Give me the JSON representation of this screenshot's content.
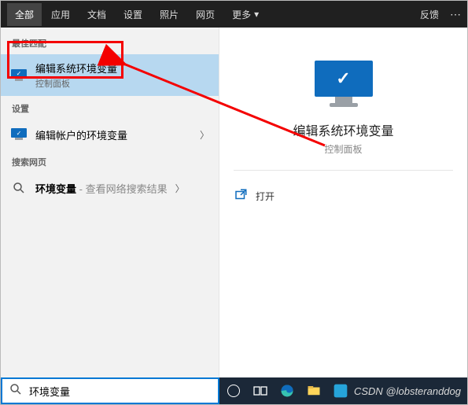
{
  "header": {
    "tabs": [
      "全部",
      "应用",
      "文档",
      "设置",
      "照片",
      "网页",
      "更多"
    ],
    "active_index": 0,
    "feedback": "反馈",
    "more": "⋯"
  },
  "left": {
    "best_match_label": "最佳匹配",
    "best_match": {
      "title": "编辑系统环境变量",
      "subtitle": "控制面板"
    },
    "settings_label": "设置",
    "settings_item": {
      "title": "编辑帐户的环境变量"
    },
    "web_label": "搜索网页",
    "web_item": {
      "query": "环境变量",
      "suffix": " - 查看网络搜索结果"
    }
  },
  "right": {
    "title": "编辑系统环境变量",
    "subtitle": "控制面板",
    "open_label": "打开"
  },
  "search": {
    "value": "环境变量",
    "placeholder": ""
  },
  "watermark": "CSDN @lobsteranddog",
  "colors": {
    "accent": "#0f6cbd",
    "highlight": "#b7d8f0",
    "annotation": "#f40000"
  }
}
